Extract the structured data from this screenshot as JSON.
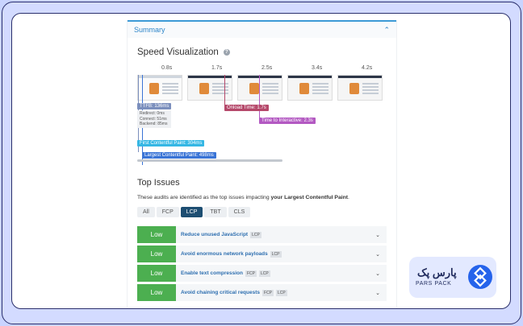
{
  "panel": {
    "title": "Summary"
  },
  "speed": {
    "title": "Speed Visualization",
    "help": "?",
    "times": [
      "0.8s",
      "1.7s",
      "2.5s",
      "3.4s",
      "4.2s"
    ],
    "markers": {
      "ttfb": "TTFB: 136ms",
      "ttfb_details": [
        "Redirect: 0ms",
        "Connect: 51ms",
        "Backend: 85ms"
      ],
      "onload": "Onload Time: 1.7s",
      "tti": "Time to Interactive: 2.3s",
      "fcp": "First Contentful Paint: 304ms",
      "lcp": "Largest Contentful Paint: 498ms"
    },
    "colors": {
      "ttfb": "#7b8fbd",
      "onload": "#b5486a",
      "tti": "#b359c2",
      "fcp": "#35b7e4",
      "lcp": "#3a74d6"
    }
  },
  "top_issues": {
    "title": "Top Issues",
    "desc_prefix": "These audits are identified as the top issues impacting ",
    "desc_bold": "your Largest Contentful Paint",
    "desc_suffix": ".",
    "tabs": [
      "All",
      "FCP",
      "LCP",
      "TBT",
      "CLS"
    ],
    "active_tab": "LCP",
    "rows": [
      {
        "impact": "Low",
        "title": "Reduce unused JavaScript",
        "tags": [
          "LCP"
        ]
      },
      {
        "impact": "Low",
        "title": "Avoid enormous network payloads",
        "tags": [
          "LCP"
        ]
      },
      {
        "impact": "Low",
        "title": "Enable text compression",
        "tags": [
          "FCP",
          "LCP"
        ]
      },
      {
        "impact": "Low",
        "title": "Avoid chaining critical requests",
        "tags": [
          "FCP",
          "LCP"
        ]
      }
    ]
  },
  "brand": {
    "fa": "پارس پک",
    "en": "PARS PACK"
  }
}
